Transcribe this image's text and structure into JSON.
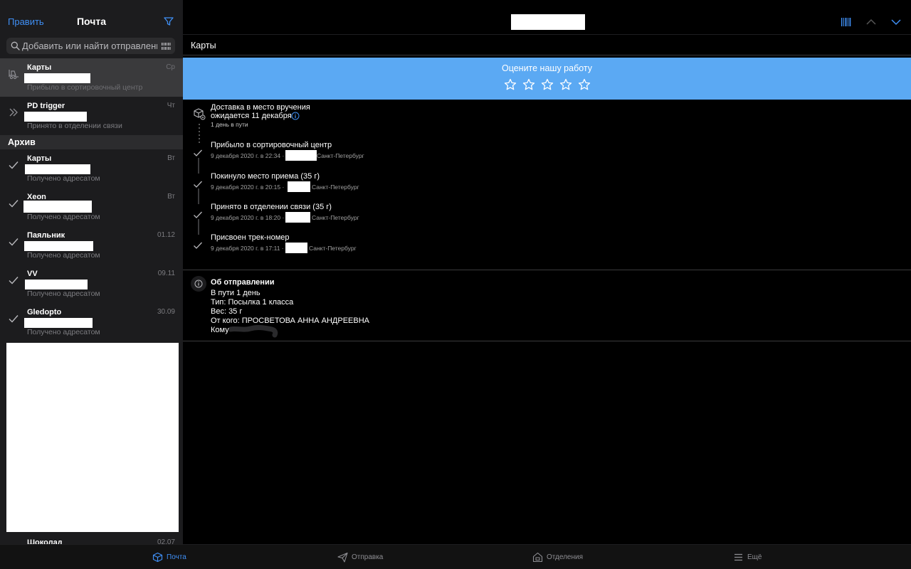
{
  "sidebar": {
    "edit_label": "Править",
    "title": "Почта",
    "search_placeholder": "Добавить или найти отправление",
    "items": [
      {
        "name": "Карты",
        "date": "Ср",
        "status": "Прибыло в сортировочный центр",
        "icon": "forklift-icon",
        "active": true
      },
      {
        "name": "PD trigger",
        "date": "Чт",
        "status": "Принято в отделении связи",
        "icon": "double-chevron-right-icon",
        "active": false
      }
    ],
    "archive_label": "Архив",
    "archive_items": [
      {
        "name": "Карты",
        "date": "Вт",
        "status": "Получено адресатом",
        "icon": "checkmark-icon"
      },
      {
        "name": "Xeon",
        "date": "Вт",
        "status": "Получено адресатом",
        "icon": "checkmark-icon"
      },
      {
        "name": "Паяльник",
        "date": "01.12",
        "status": "Получено адресатом",
        "icon": "checkmark-icon"
      },
      {
        "name": "VV",
        "date": "09.11",
        "status": "Получено адресатом",
        "icon": "checkmark-icon"
      },
      {
        "name": "Gledopto",
        "date": "30.09",
        "status": "Получено адресатом",
        "icon": "checkmark-icon"
      },
      {
        "name": "Шоколад",
        "date": "02.07",
        "status": "",
        "icon": "checkmark-icon"
      }
    ]
  },
  "main": {
    "breadcrumb": "Карты",
    "rating": {
      "title": "Оцените нашу работу",
      "stars_total": 5,
      "stars_filled": 0
    },
    "expected": {
      "line1": "Доставка в место вручения",
      "line2": "ожидается 11 декабря",
      "days_in_transit": "1 день в пути"
    },
    "events": [
      {
        "title": "Прибыло в сортировочный центр",
        "date": "9 декабря 2020 г. в 22:34 ·",
        "city": "Санкт-Петербург"
      },
      {
        "title": "Покинуло место приема  (35 г)",
        "date": "9 декабря 2020 г. в 20:15 ·",
        "city": "Санкт-Петербург"
      },
      {
        "title": "Принято в отделении связи  (35 г)",
        "date": "9 декабря 2020 г. в 18:20 ·",
        "city": "Санкт-Петербург"
      },
      {
        "title": "Присвоен трек-номер",
        "date": "9 декабря 2020 г. в 17:11 ·",
        "city": "Санкт-Петербург"
      }
    ],
    "about": {
      "title": "Об отправлении",
      "in_transit": "В пути 1 день",
      "type": "Тип: Посылка 1 класса",
      "weight": "Вес: 35 г",
      "from": "От кого: ПРОСВЕТОВА АННА АНДРЕЕВНА",
      "to": "Кому"
    }
  },
  "tabbar": {
    "tabs": [
      {
        "label": "Почта",
        "icon": "package-icon",
        "active": true
      },
      {
        "label": "Отправка",
        "icon": "paper-plane-icon",
        "active": false
      },
      {
        "label": "Отделения",
        "icon": "post-office-icon",
        "active": false
      },
      {
        "label": "Ещё",
        "icon": "menu-icon",
        "active": false
      }
    ]
  },
  "colors": {
    "accent": "#3f8ff5",
    "rating_banner": "#5ba9f3",
    "sidebar_bg": "#1c1c1e",
    "selected_row": "#3a3a3c"
  }
}
